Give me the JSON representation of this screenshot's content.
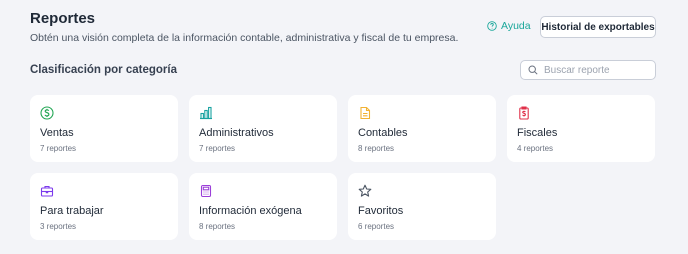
{
  "header": {
    "title": "Reportes",
    "subtitle": "Obtén una visión completa de la información contable, administrativa y fiscal de tu empresa.",
    "help_label": "Ayuda",
    "history_button_label": "Historial de exportables"
  },
  "section": {
    "title": "Clasificación por categoría"
  },
  "search": {
    "placeholder": "Buscar reporte",
    "value": ""
  },
  "colors": {
    "teal": "#1aa79a",
    "ventas": "#22a654",
    "administrativos": "#17a2a0",
    "contables": "#f2b233",
    "fiscales": "#e0304a",
    "para_trabajar": "#7c3aed",
    "informacion_exogena": "#9b3fd8",
    "favoritos": "#4b5563"
  },
  "cards": [
    {
      "title": "Ventas",
      "count": "7 reportes",
      "icon": "dollar-circle-icon"
    },
    {
      "title": "Administrativos",
      "count": "7 reportes",
      "icon": "bar-chart-icon"
    },
    {
      "title": "Contables",
      "count": "8 reportes",
      "icon": "document-icon"
    },
    {
      "title": "Fiscales",
      "count": "4 reportes",
      "icon": "tax-receipt-icon"
    },
    {
      "title": "Para trabajar",
      "count": "3 reportes",
      "icon": "briefcase-icon"
    },
    {
      "title": "Información exógena",
      "count": "8 reportes",
      "icon": "calculator-icon"
    },
    {
      "title": "Favoritos",
      "count": "6 reportes",
      "icon": "star-icon"
    }
  ]
}
